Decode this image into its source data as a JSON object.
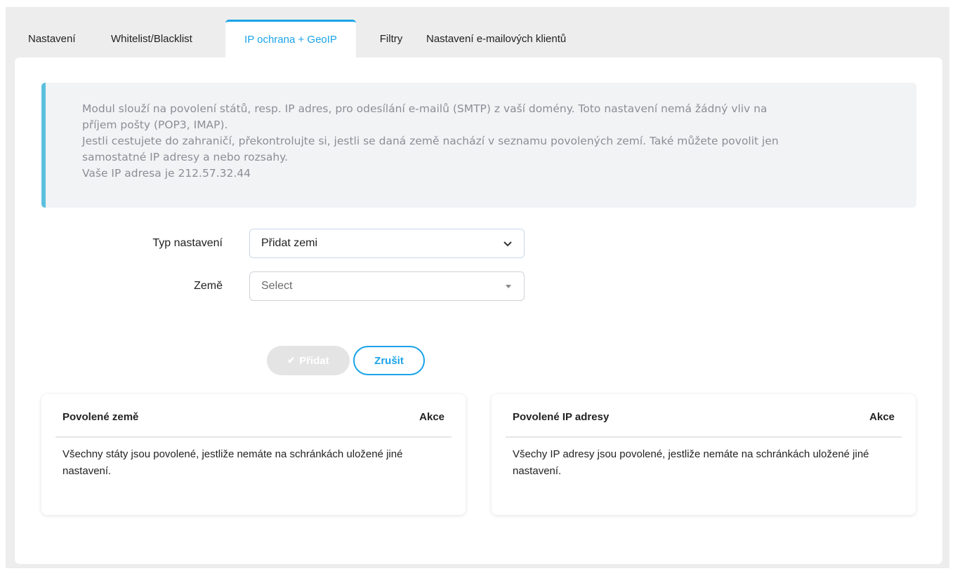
{
  "tabs": [
    {
      "label": "Nastavení"
    },
    {
      "label": "Whitelist/Blacklist"
    },
    {
      "label": "IP ochrana + GeoIP"
    },
    {
      "label": "Filtry"
    },
    {
      "label": "Nastavení e-mailových klientů"
    }
  ],
  "info": {
    "line1": "Modul slouží na povolení států, resp. IP adres, pro odesílání e-mailů (SMTP) z vaší domény. Toto nastavení nemá žádný vliv na\npříjem pošty (POP3, IMAP).",
    "line2": "Jestli cestujete do zahraničí, překontrolujte si, jestli se daná země nachází v seznamu povolených zemí. Také můžete povolit jen\nsamostatné IP adresy a nebo rozsahy.",
    "line3": "Vaše IP adresa je 212.57.32.44"
  },
  "form": {
    "type_label": "Typ nastavení",
    "type_value": "Přidat zemi",
    "country_label": "Země",
    "country_placeholder": "Select"
  },
  "buttons": {
    "add": "Přidat",
    "cancel": "Zrušit"
  },
  "countries_card": {
    "title": "Povolené země",
    "action": "Akce",
    "empty": "Všechny státy jsou povolené, jestliže nemáte na schránkách uložené jiné nastavení."
  },
  "ips_card": {
    "title": "Povolené IP adresy",
    "action": "Akce",
    "empty": "Všechy IP adresy jsou povolené, jestliže nemáte na schránkách uložené jiné nastavení."
  },
  "colors": {
    "accent": "#1aa3e8",
    "info_border": "#5bc0de",
    "info_bg": "#f2f3f5"
  }
}
